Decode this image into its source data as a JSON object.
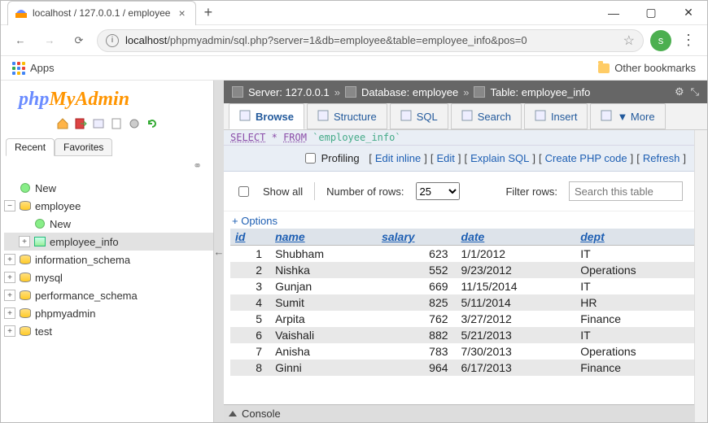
{
  "chrome": {
    "tab_title": "localhost / 127.0.0.1 / employee",
    "url_host": "localhost",
    "url_path": "/phpmyadmin/sql.php?server=1&db=employee&table=employee_info&pos=0",
    "apps_label": "Apps",
    "other_bookmarks": "Other bookmarks",
    "avatar_letter": "s"
  },
  "logo": {
    "left": "php",
    "right": "MyAdmin"
  },
  "sidebar_tabs": {
    "recent": "Recent",
    "favorites": "Favorites"
  },
  "tree": {
    "new": "New",
    "db": "employee",
    "db_new": "New",
    "table": "employee_info",
    "others": [
      "information_schema",
      "mysql",
      "performance_schema",
      "phpmyadmin",
      "test"
    ]
  },
  "breadcrumb": {
    "server_label": "Server: 127.0.0.1",
    "db_label": "Database: employee",
    "table_label": "Table: employee_info"
  },
  "menutabs": [
    "Browse",
    "Structure",
    "SQL",
    "Search",
    "Insert",
    "More"
  ],
  "more_marker": "▼",
  "query": {
    "select": "SELECT",
    "star": "*",
    "from": "FROM",
    "ident": "`employee_info`"
  },
  "actions": {
    "profiling": "Profiling",
    "edit_inline": "Edit inline",
    "edit": "Edit",
    "explain": "Explain SQL",
    "create_php": "Create PHP code",
    "refresh": "Refresh"
  },
  "controls": {
    "show_all": "Show all",
    "num_rows_label": "Number of rows:",
    "num_rows_value": "25",
    "filter_label": "Filter rows:",
    "filter_placeholder": "Search this table"
  },
  "options_link": "+ Options",
  "table": {
    "headers": [
      "id",
      "name",
      "salary",
      "date",
      "dept"
    ],
    "rows": [
      {
        "id": "1",
        "name": "Shubham",
        "salary": "623",
        "date": "1/1/2012",
        "dept": "IT"
      },
      {
        "id": "2",
        "name": "Nishka",
        "salary": "552",
        "date": "9/23/2012",
        "dept": "Operations"
      },
      {
        "id": "3",
        "name": "Gunjan",
        "salary": "669",
        "date": "11/15/2014",
        "dept": "IT"
      },
      {
        "id": "4",
        "name": "Sumit",
        "salary": "825",
        "date": "5/11/2014",
        "dept": "HR"
      },
      {
        "id": "5",
        "name": "Arpita",
        "salary": "762",
        "date": "3/27/2012",
        "dept": "Finance"
      },
      {
        "id": "6",
        "name": "Vaishali",
        "salary": "882",
        "date": "5/21/2013",
        "dept": "IT"
      },
      {
        "id": "7",
        "name": "Anisha",
        "salary": "783",
        "date": "7/30/2013",
        "dept": "Operations"
      },
      {
        "id": "8",
        "name": "Ginni",
        "salary": "964",
        "date": "6/17/2013",
        "dept": "Finance"
      }
    ]
  },
  "console": "Console"
}
